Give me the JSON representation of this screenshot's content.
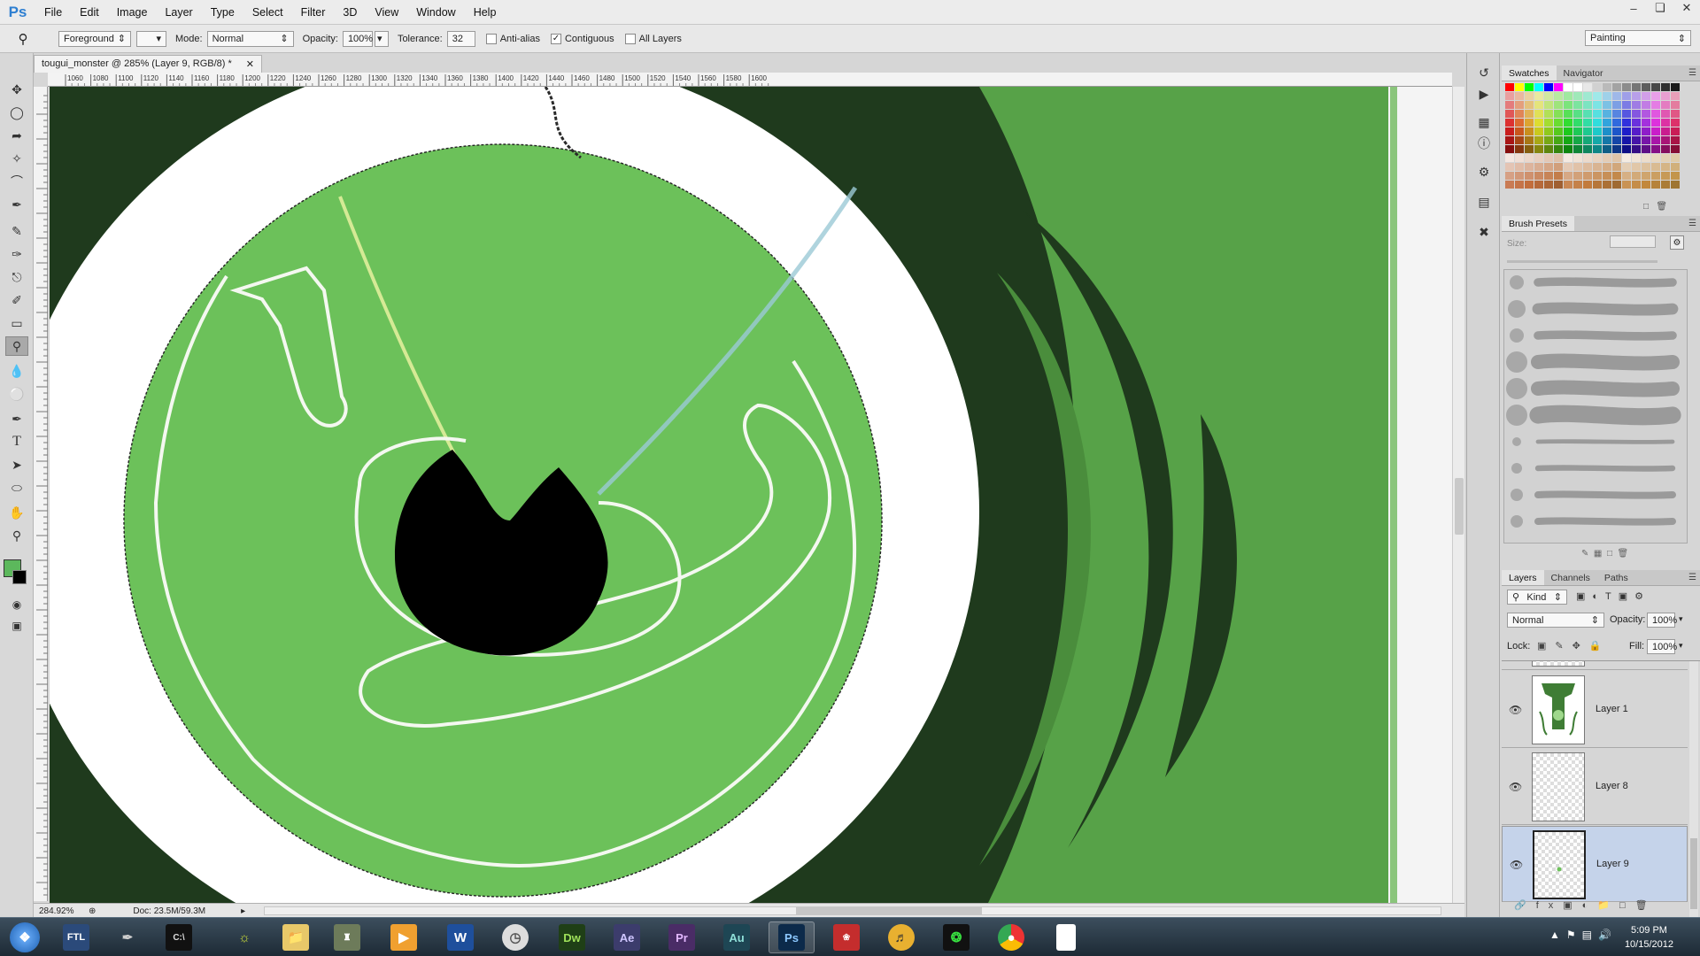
{
  "app": {
    "logo": "Ps"
  },
  "menu": [
    "File",
    "Edit",
    "Image",
    "Layer",
    "Type",
    "Select",
    "Filter",
    "3D",
    "View",
    "Window",
    "Help"
  ],
  "window_controls": [
    "minimize-icon",
    "restore-icon",
    "close-icon"
  ],
  "options": {
    "fill_source": "Foreground",
    "mode_label": "Mode:",
    "mode_value": "Normal",
    "opacity_label": "Opacity:",
    "opacity_value": "100%",
    "tolerance_label": "Tolerance:",
    "tolerance_value": "32",
    "antialias_label": "Anti-alias",
    "antialias_checked": false,
    "contiguous_label": "Contiguous",
    "contiguous_checked": true,
    "alllayers_label": "All Layers",
    "alllayers_checked": false,
    "workspace": "Painting"
  },
  "document": {
    "tab_title": "tougui_monster @ 285% (Layer 9, RGB/8) *",
    "ruler_ticks": [
      "1060",
      "1080",
      "1100",
      "1120",
      "1140",
      "1160",
      "1180",
      "1200",
      "1220",
      "1240",
      "1260",
      "1280",
      "1300",
      "1320",
      "1340",
      "1360",
      "1380",
      "1400",
      "1420",
      "1440",
      "1460",
      "1480",
      "1500",
      "1520",
      "1540",
      "1560",
      "1580",
      "1600"
    ],
    "zoom": "284.92%",
    "doc_size": "Doc: 23.5M/59.3M"
  },
  "tools": [
    "move-tool",
    "marquee-tool",
    "lasso-tool",
    "quick-select-tool",
    "crop-tool",
    "eyedropper-tool",
    "healing-tool",
    "brush-tool",
    "clone-stamp-tool",
    "history-brush-tool",
    "eraser-tool",
    "paint-bucket-tool",
    "blur-tool",
    "dodge-tool",
    "pen-tool",
    "type-tool",
    "path-select-tool",
    "ellipse-tool",
    "hand-tool",
    "zoom-tool"
  ],
  "colors": {
    "foreground": "#5cb85c",
    "background": "#000000",
    "canvas_green": "#6cc15a",
    "dark_green": "#1f3a1d",
    "mid_green": "#58a446"
  },
  "swatches_panel": {
    "tabs": [
      "Swatches",
      "Navigator"
    ]
  },
  "brush_panel": {
    "tab": "Brush Presets",
    "size_label": "Size:"
  },
  "layers_panel": {
    "tabs": [
      "Layers",
      "Channels",
      "Paths"
    ],
    "kind_filter": "Kind",
    "blend_mode": "Normal",
    "opacity_label": "Opacity:",
    "opacity_value": "100%",
    "lock_label": "Lock:",
    "fill_label": "Fill:",
    "fill_value": "100%",
    "layers": [
      {
        "name": "Layer 1",
        "visible": true,
        "selected": false
      },
      {
        "name": "Layer 8",
        "visible": true,
        "selected": false
      },
      {
        "name": "Layer 9",
        "visible": true,
        "selected": true
      }
    ]
  },
  "taskbar": {
    "apps": [
      "start-orb",
      "FTL",
      "feather-app",
      "terminal-app",
      "antenna-app",
      "explorer-app",
      "game-app",
      "media-app",
      "Word",
      "browser-app",
      "Dw",
      "Ae",
      "Pr",
      "Au",
      "Ps",
      "gimp-app",
      "fruity-loops-app",
      "razer-app",
      "chrome-app",
      "notepad-app"
    ],
    "time": "5:09 PM",
    "date": "10/15/2012"
  }
}
